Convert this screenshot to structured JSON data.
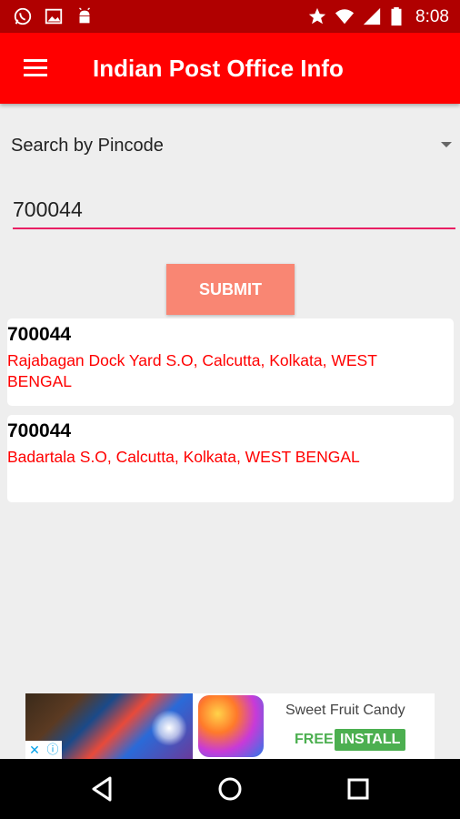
{
  "status_bar": {
    "time": "8:08",
    "icons": [
      "whatsapp-icon",
      "image-icon",
      "android-icon",
      "star-icon",
      "wifi-icon",
      "signal-icon",
      "battery-icon"
    ]
  },
  "app_bar": {
    "title": "Indian Post Office Info",
    "menu_icon": "hamburger-menu-icon"
  },
  "search": {
    "type_label": "Search by Pincode",
    "pincode_value": "700044",
    "submit_label": "SUBMIT"
  },
  "results": [
    {
      "pincode": "700044",
      "address": "Rajabagan Dock Yard S.O, Calcutta, Kolkata, WEST BENGAL"
    },
    {
      "pincode": "700044",
      "address": "Badartala S.O, Calcutta, Kolkata, WEST BENGAL"
    }
  ],
  "ad": {
    "title": "Sweet Fruit Candy",
    "free_label": "FREE",
    "install_label": "INSTALL"
  },
  "colors": {
    "status_bar": "#b00000",
    "app_bar": "#ff0000",
    "submit_button": "#f98673",
    "address_text": "#ff0000",
    "input_underline": "#e91e63"
  }
}
